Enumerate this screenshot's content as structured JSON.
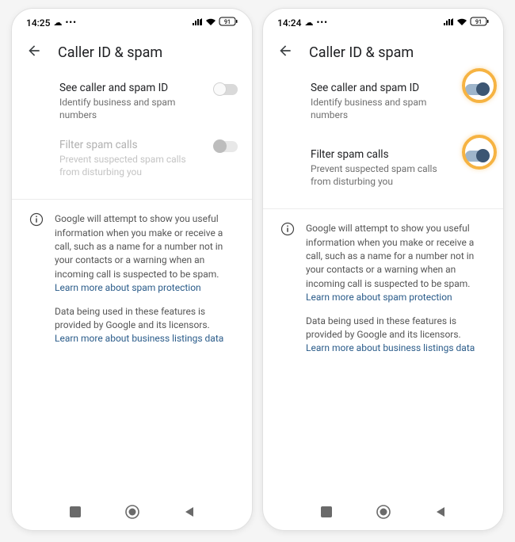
{
  "left": {
    "status": {
      "time": "14:25",
      "battery": "91"
    },
    "title": "Caller ID & spam",
    "setting1": {
      "title": "See caller and spam ID",
      "subtitle": "Identify business and spam numbers"
    },
    "setting2": {
      "title": "Filter spam calls",
      "subtitle": "Prevent suspected spam calls from disturbing you"
    },
    "info": {
      "p1a": "Google will attempt to show you useful information when you make or receive a call, such as a name for a number not in your contacts or a warning when an incoming call is suspected to be spam. ",
      "link1": "Learn more about spam protection",
      "p2a": "Data being used in these features is provided by Google and its licensors. ",
      "link2": "Learn more about business listings data"
    }
  },
  "right": {
    "status": {
      "time": "14:24",
      "battery": "91"
    },
    "title": "Caller ID & spam",
    "setting1": {
      "title": "See caller and spam ID",
      "subtitle": "Identify business and spam numbers"
    },
    "setting2": {
      "title": "Filter spam calls",
      "subtitle": "Prevent suspected spam calls from disturbing you"
    },
    "info": {
      "p1a": "Google will attempt to show you useful information when you make or receive a call, such as a name for a number not in your contacts or a warning when an incoming call is suspected to be spam. ",
      "link1": "Learn more about spam protection",
      "p2a": "Data being used in these features is provided by Google and its licensors. ",
      "link2": "Learn more about business listings data"
    }
  }
}
